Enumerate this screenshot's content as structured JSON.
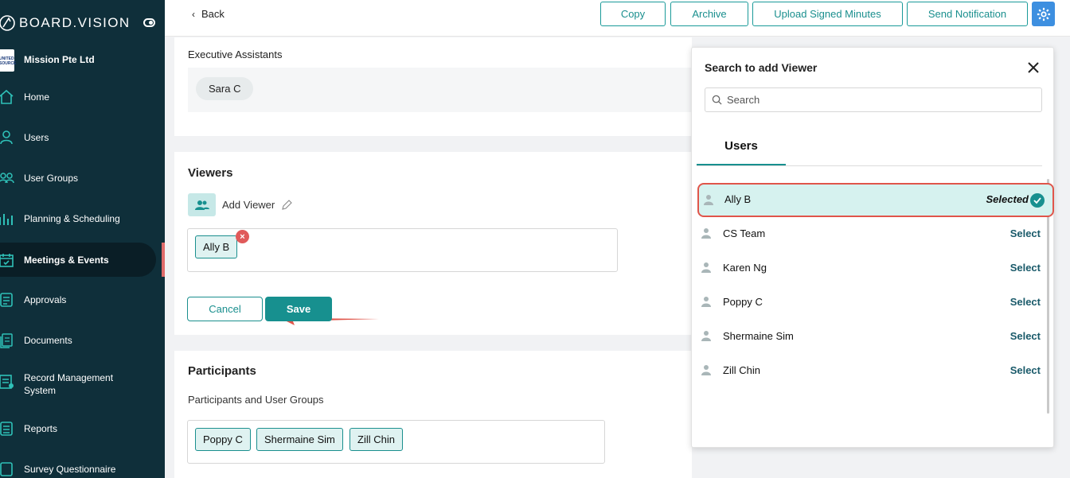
{
  "brand": {
    "name": "BOARD.VISION"
  },
  "organization": {
    "name": "Mission Pte Ltd",
    "logo_text": "UNITED SOURCE"
  },
  "sidebar": {
    "items": [
      {
        "label": "Home",
        "icon": "home-icon"
      },
      {
        "label": "Users",
        "icon": "user-icon"
      },
      {
        "label": "User Groups",
        "icon": "users-icon"
      },
      {
        "label": "Planning & Scheduling",
        "icon": "chart-icon"
      },
      {
        "label": "Meetings & Events",
        "icon": "calendar-icon",
        "active": true
      },
      {
        "label": "Approvals",
        "icon": "clipboard-icon"
      },
      {
        "label": "Documents",
        "icon": "documents-icon"
      },
      {
        "label": "Record Management System",
        "icon": "record-icon"
      },
      {
        "label": "Reports",
        "icon": "report-icon"
      },
      {
        "label": "Survey Questionnaire",
        "icon": "survey-icon"
      }
    ]
  },
  "topbar": {
    "back_label": "Back",
    "buttons": [
      "Copy",
      "Archive",
      "Upload Signed Minutes",
      "Send Notification"
    ]
  },
  "executive": {
    "label": "Executive Assistants",
    "chips": [
      "Sara C"
    ]
  },
  "viewers": {
    "title": "Viewers",
    "add_label": "Add Viewer",
    "chips": [
      "Ally B"
    ],
    "cancel_label": "Cancel",
    "save_label": "Save"
  },
  "participants": {
    "title": "Participants",
    "subtitle": "Participants and User Groups",
    "chips": [
      "Poppy C",
      "Shermaine Sim",
      "Zill Chin"
    ]
  },
  "panel": {
    "title": "Search to add Viewer",
    "search_placeholder": "Search",
    "tab": "Users",
    "users": [
      {
        "name": "Ally B",
        "action": "Selected",
        "selected": true
      },
      {
        "name": "CS Team",
        "action": "Select"
      },
      {
        "name": "Karen Ng",
        "action": "Select"
      },
      {
        "name": "Poppy C",
        "action": "Select"
      },
      {
        "name": "Shermaine Sim",
        "action": "Select"
      },
      {
        "name": "Zill Chin",
        "action": "Select"
      }
    ]
  },
  "colors": {
    "sidebar_bg": "#0f2f3a",
    "accent": "#17908f",
    "highlight": "#e0554a",
    "gear_button": "#3d8fe0"
  }
}
